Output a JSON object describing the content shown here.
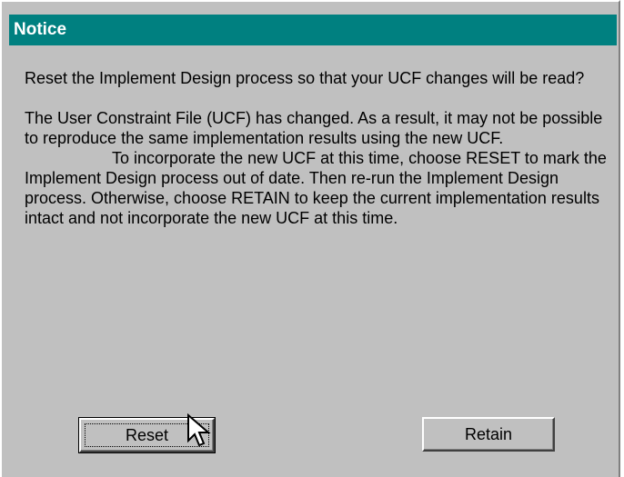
{
  "dialog": {
    "title": "Notice",
    "question": "Reset the Implement Design process so that your UCF changes will be read?",
    "body_line1": "The User Constraint File (UCF) has changed. As a result, it may not be possible to reproduce the same implementation results using the new UCF.",
    "body_line2": "To incorporate the new UCF at this time, choose RESET to mark the Implement Design process out of date. Then re-run the Implement Design process. Otherwise, choose RETAIN to keep the current implementation results intact and not incorporate the new UCF at this time."
  },
  "buttons": {
    "reset_label": "Reset",
    "retain_label": "Retain"
  },
  "colors": {
    "titlebar": "#008080",
    "dialog_bg": "#c0c0c0"
  },
  "icons": {
    "cursor": "arrow-pointer-icon"
  }
}
